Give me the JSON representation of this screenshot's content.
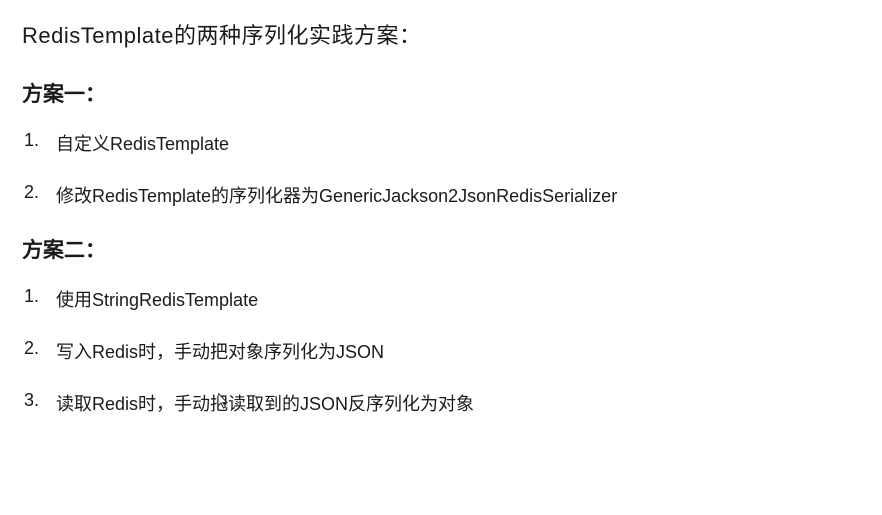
{
  "title": "RedisTemplate的两种序列化实践方案：",
  "sections": [
    {
      "heading": "方案一：",
      "items": [
        {
          "num": "1.",
          "text": "自定义RedisTemplate"
        },
        {
          "num": "2.",
          "text": "修改RedisTemplate的序列化器为GenericJackson2JsonRedisSerializer"
        }
      ]
    },
    {
      "heading": "方案二：",
      "items": [
        {
          "num": "1.",
          "text": "使用StringRedisTemplate"
        },
        {
          "num": "2.",
          "text": "写入Redis时，手动把对象序列化为JSON"
        },
        {
          "num": "3.",
          "text": "读取Redis时，手动把读取到的JSON反序列化为对象"
        }
      ]
    }
  ]
}
